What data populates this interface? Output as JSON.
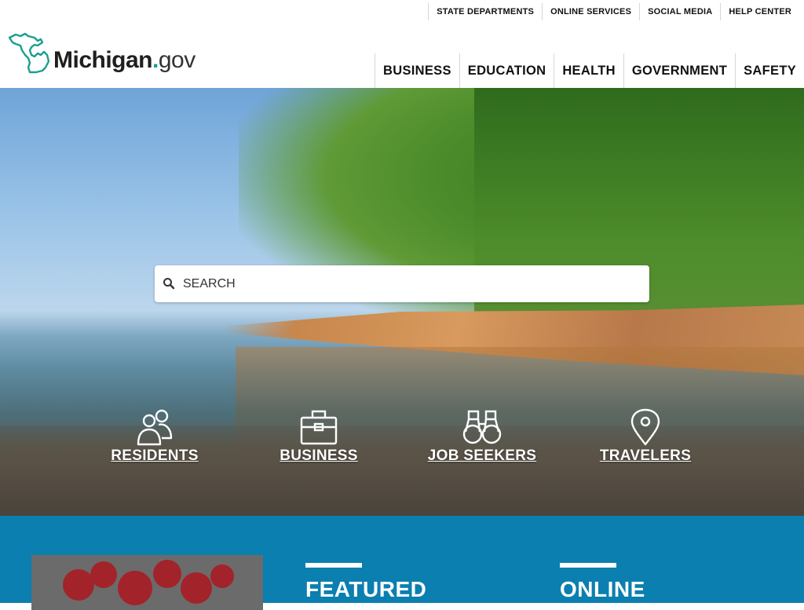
{
  "header": {
    "utility_nav": [
      "STATE DEPARTMENTS",
      "ONLINE SERVICES",
      "SOCIAL MEDIA",
      "HELP CENTER"
    ],
    "logo": {
      "name": "Michigan",
      "dot": ".",
      "tld": "gov"
    },
    "main_nav": [
      "BUSINESS",
      "EDUCATION",
      "HEALTH",
      "GOVERNMENT",
      "SAFETY"
    ]
  },
  "hero": {
    "search": {
      "placeholder": "SEARCH",
      "icon": "search-icon"
    },
    "audiences": [
      {
        "label": "RESIDENTS",
        "icon": "people-icon"
      },
      {
        "label": "BUSINESS",
        "icon": "briefcase-icon"
      },
      {
        "label": "JOB SEEKERS",
        "icon": "binoculars-icon"
      },
      {
        "label": "TRAVELERS",
        "icon": "map-pin-icon"
      }
    ]
  },
  "sections": {
    "featured": "FEATURED",
    "online": "ONLINE"
  },
  "colors": {
    "band": "#0b7fb0",
    "logo_accent": "#1b9f8e"
  }
}
